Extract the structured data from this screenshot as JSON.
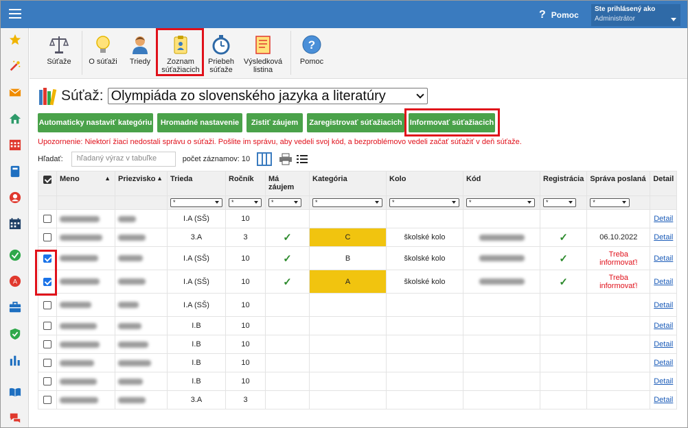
{
  "header": {
    "help_label": "Pomoc",
    "help_icon": "?",
    "user_line1": "Ste prihlásený ako",
    "user_line2": "Administrátor"
  },
  "sidebar": {
    "icons": [
      "star-icon",
      "magic-wand-icon",
      "mail-icon",
      "home-icon",
      "calendar-grid-icon",
      "book-icon",
      "person-icon",
      "schedule-icon",
      "check-circle-icon",
      "award-icon",
      "briefcase-icon",
      "shield-icon",
      "bar-chart-icon",
      "open-book-icon",
      "chat-icon"
    ]
  },
  "toolbar": {
    "items": [
      {
        "label1": "Súťaže",
        "label2": "",
        "icon": "scales-icon"
      },
      {
        "label1": "O súťaži",
        "label2": "",
        "icon": "lightbulb-icon"
      },
      {
        "label1": "Triedy",
        "label2": "",
        "icon": "person-icon"
      },
      {
        "label1": "Zoznam",
        "label2": "súťažiacich",
        "icon": "clipboard-icon"
      },
      {
        "label1": "Priebeh",
        "label2": "súťaže",
        "icon": "stopwatch-icon"
      },
      {
        "label1": "Výsledková",
        "label2": "listina",
        "icon": "certificate-icon"
      },
      {
        "label1": "Pomoc",
        "label2": "",
        "icon": "help-icon"
      }
    ]
  },
  "competition": {
    "label": "Súťaž:",
    "selected": "Olympiáda zo slovenského jazyka a literatúry"
  },
  "actions": {
    "auto_category": "Automaticky nastaviť kategóriu",
    "bulk_settings": "Hromadné nastavenie",
    "find_interest": "Zistiť záujem",
    "register": "Zaregistrovať súťažiacich",
    "inform": "Informovať súťažiacich"
  },
  "warning": "Upozornenie: Niektorí žiaci nedostali správu o súťaži. Pošlite im správu, aby vedeli svoj kód, a bezproblémovo vedeli začať súťažiť v deň súťaže.",
  "search": {
    "label": "Hľadať:",
    "placeholder": "hľadaný výraz v tabuľke",
    "count_label": "počet záznamov: 10"
  },
  "table": {
    "headers": {
      "meno": "Meno",
      "priezvisko": "Priezvisko",
      "trieda": "Trieda",
      "rocnik": "Ročník",
      "zaujem": "Má záujem",
      "kategoria": "Kategória",
      "kolo": "Kolo",
      "kod": "Kód",
      "registracia": "Registrácia",
      "sprava": "Správa poslaná",
      "detail": "Detail"
    },
    "filter_value": "*",
    "rows": [
      {
        "checked": false,
        "trieda": "I.A (SŠ)",
        "rocnik": "10",
        "zaujem": "",
        "kategoria": "",
        "kolo": "",
        "registracia": "",
        "sprava": "",
        "detail": "Detail"
      },
      {
        "checked": false,
        "trieda": "3.A",
        "rocnik": "3",
        "zaujem": "✓",
        "kategoria": "C",
        "kolo": "školské kolo",
        "registracia": "✓",
        "sprava": "06.10.2022",
        "detail": "Detail"
      },
      {
        "checked": true,
        "trieda": "I.A (SŠ)",
        "rocnik": "10",
        "zaujem": "✓",
        "kategoria": "B",
        "kolo": "školské kolo",
        "registracia": "✓",
        "sprava": "Treba informovať!",
        "detail": "Detail"
      },
      {
        "checked": true,
        "trieda": "I.A (SŠ)",
        "rocnik": "10",
        "zaujem": "✓",
        "kategoria": "A",
        "kolo": "školské kolo",
        "registracia": "✓",
        "sprava": "Treba informovať!",
        "detail": "Detail"
      },
      {
        "checked": false,
        "trieda": "I.A (SŠ)",
        "rocnik": "10",
        "zaujem": "",
        "kategoria": "",
        "kolo": "",
        "registracia": "",
        "sprava": "",
        "detail": "Detail"
      },
      {
        "checked": false,
        "trieda": "I.B",
        "rocnik": "10",
        "zaujem": "",
        "kategoria": "",
        "kolo": "",
        "registracia": "",
        "sprava": "",
        "detail": "Detail"
      },
      {
        "checked": false,
        "trieda": "I.B",
        "rocnik": "10",
        "zaujem": "",
        "kategoria": "",
        "kolo": "",
        "registracia": "",
        "sprava": "",
        "detail": "Detail"
      },
      {
        "checked": false,
        "trieda": "I.B",
        "rocnik": "10",
        "zaujem": "",
        "kategoria": "",
        "kolo": "",
        "registracia": "",
        "sprava": "",
        "detail": "Detail"
      },
      {
        "checked": false,
        "trieda": "I.B",
        "rocnik": "10",
        "zaujem": "",
        "kategoria": "",
        "kolo": "",
        "registracia": "",
        "sprava": "",
        "detail": "Detail"
      },
      {
        "checked": false,
        "trieda": "3.A",
        "rocnik": "3",
        "zaujem": "",
        "kategoria": "",
        "kolo": "",
        "registracia": "",
        "sprava": "",
        "detail": "Detail"
      }
    ]
  },
  "colors": {
    "topbar": "#3a7bbf",
    "button_green": "#4aa24a",
    "highlight_red": "#e0101a",
    "category_yellow": "#f1c40f"
  }
}
